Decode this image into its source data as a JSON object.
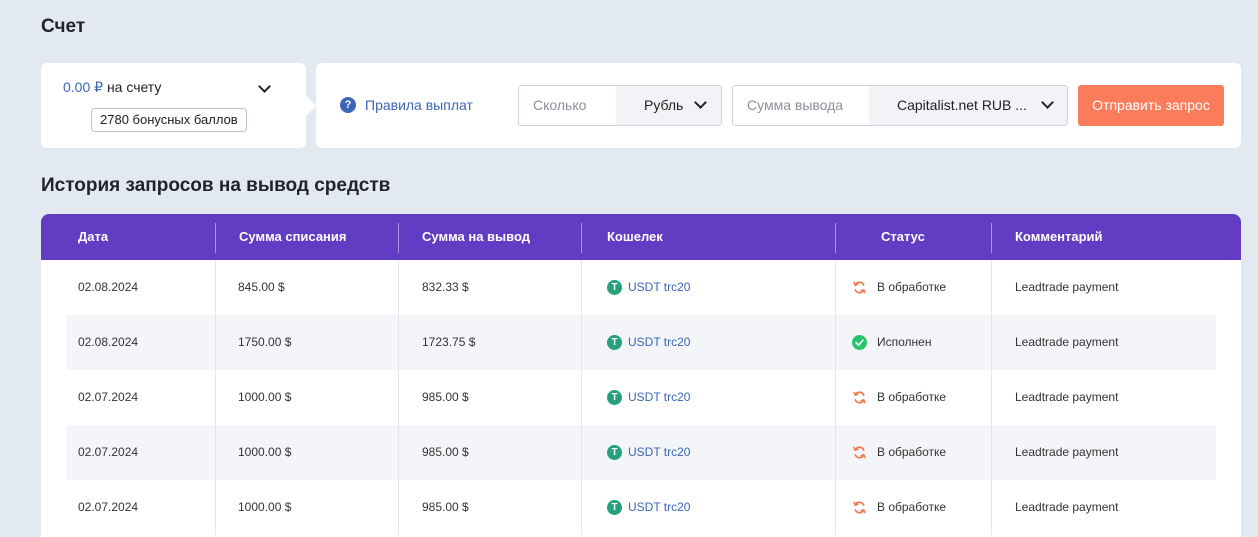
{
  "account": {
    "title": "Счет",
    "balance_amount": "0.00 ₽",
    "balance_label": "на счету",
    "bonus": "2780 бонусных баллов"
  },
  "withdraw": {
    "rules_link": "Правила выплат",
    "amount_placeholder": "Сколько",
    "currency": "Рубль",
    "sum_placeholder": "Сумма вывода",
    "method": "Capitalist.net RUB ...",
    "submit": "Отправить запрос"
  },
  "history": {
    "title": "История запросов на вывод средств",
    "columns": [
      "Дата",
      "Сумма списания",
      "Сумма на вывод",
      "Кошелек",
      "Статус",
      "Комментарий"
    ],
    "rows": [
      {
        "date": "02.08.2024",
        "debit": "845.00 $",
        "payout": "832.33 $",
        "wallet": "USDT trc20",
        "status": "В обработке",
        "status_icon": "processing-icon",
        "comment": "Leadtrade payment"
      },
      {
        "date": "02.08.2024",
        "debit": "1750.00 $",
        "payout": "1723.75 $",
        "wallet": "USDT trc20",
        "status": "Исполнен",
        "status_icon": "check-circle-icon",
        "comment": "Leadtrade payment"
      },
      {
        "date": "02.07.2024",
        "debit": "1000.00 $",
        "payout": "985.00 $",
        "wallet": "USDT trc20",
        "status": "В обработке",
        "status_icon": "processing-icon",
        "comment": "Leadtrade payment"
      },
      {
        "date": "02.07.2024",
        "debit": "1000.00 $",
        "payout": "985.00 $",
        "wallet": "USDT trc20",
        "status": "В обработке",
        "status_icon": "processing-icon",
        "comment": "Leadtrade payment"
      },
      {
        "date": "02.07.2024",
        "debit": "1000.00 $",
        "payout": "985.00 $",
        "wallet": "USDT trc20",
        "status": "В обработке",
        "status_icon": "processing-icon",
        "comment": "Leadtrade payment"
      }
    ]
  },
  "colors": {
    "header_bg": "#623dc4",
    "accent_blue": "#3a66b5",
    "button": "#fa7c5a",
    "tether": "#26a17b",
    "processing": "#f07b4f",
    "success": "#27c46b"
  }
}
